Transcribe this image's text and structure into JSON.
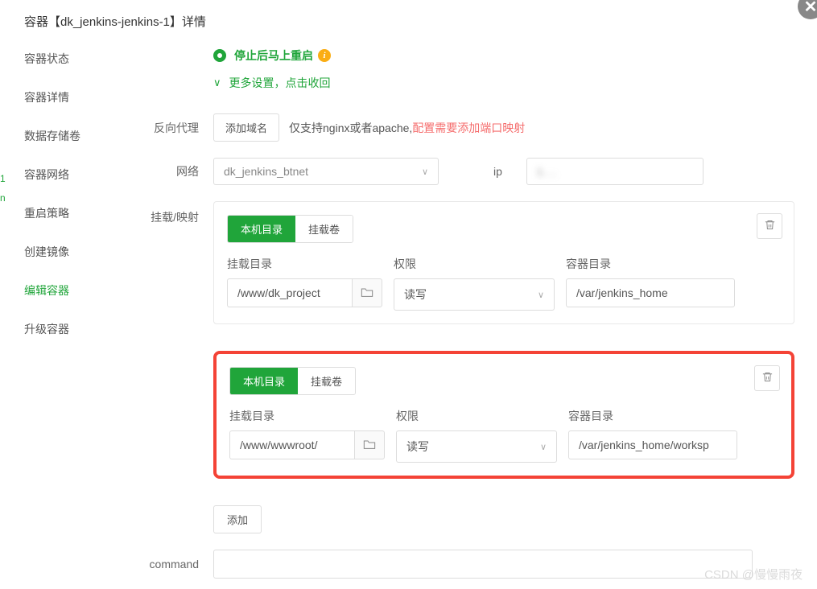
{
  "header": {
    "title": "容器【dk_jenkins-jenkins-1】详情"
  },
  "sidebar": {
    "items": [
      {
        "label": "容器状态"
      },
      {
        "label": "容器详情"
      },
      {
        "label": "数据存储卷"
      },
      {
        "label": "容器网络"
      },
      {
        "label": "重启策略"
      },
      {
        "label": "创建镜像"
      },
      {
        "label": "编辑容器",
        "active": true
      },
      {
        "label": "升级容器"
      }
    ]
  },
  "restart": {
    "option_label": "停止后马上重启",
    "more_settings": "更多设置，点击收回"
  },
  "proxy": {
    "label": "反向代理",
    "add_domain": "添加域名",
    "help_text": "仅支持nginx或者apache,",
    "help_warn": "配置需要添加端口映射"
  },
  "network": {
    "label": "网络",
    "selected": "dk_jenkins_btnet",
    "ip_label": "ip",
    "ip_value": "1..."
  },
  "mount": {
    "label": "挂载/映射",
    "tabs": {
      "local": "本机目录",
      "volume": "挂载卷"
    },
    "fields": {
      "mount_dir": "挂载目录",
      "perm": "权限",
      "container_dir": "容器目录"
    },
    "perm_value": "读写",
    "rows": [
      {
        "host_path": "/www/dk_project",
        "container_path": "/var/jenkins_home"
      },
      {
        "host_path": "/www/wwwroot/",
        "container_path": "/var/jenkins_home/worksp"
      }
    ],
    "add_label": "添加"
  },
  "command": {
    "label": "command",
    "value": ""
  },
  "watermark": "CSDN @慢慢雨夜",
  "edge_hints": [
    "1",
    "n"
  ]
}
